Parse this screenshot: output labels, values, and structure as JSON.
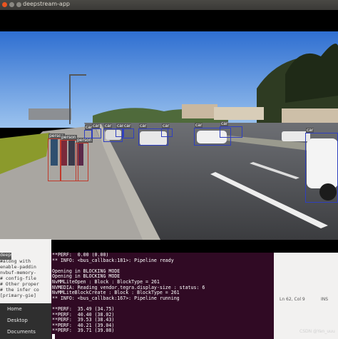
{
  "window": {
    "title": "deepstream-app"
  },
  "detections": [
    {
      "label": "person",
      "color": "#c0392b"
    },
    {
      "label": "person",
      "color": "#c0392b"
    },
    {
      "label": "person",
      "color": "#c0392b"
    },
    {
      "label": "car",
      "color": "#2f3fbf"
    },
    {
      "label": "car",
      "color": "#2f3fbf"
    },
    {
      "label": "car",
      "color": "#2f3fbf"
    },
    {
      "label": "car",
      "color": "#2f3fbf"
    },
    {
      "label": "car",
      "color": "#2f3fbf"
    },
    {
      "label": "car",
      "color": "#2f3fbf"
    },
    {
      "label": "car",
      "color": "#2f3fbf"
    },
    {
      "label": "car",
      "color": "#2f3fbf"
    },
    {
      "label": "car",
      "color": "#2f3fbf"
    },
    {
      "label": "car",
      "color": "#2f3fbf"
    }
  ],
  "editor": {
    "tab_label": "deepstre",
    "lines": [
      "#along with",
      "enable-paddin",
      "nvbuf-memory-",
      "",
      "# config-file",
      "# Other proper",
      "# the infer co",
      "[primary-gie]"
    ]
  },
  "sidebar": {
    "items": [
      "Home",
      "Desktop",
      "Documents"
    ]
  },
  "right_panel": {
    "status": "Ln 62, Col 9",
    "mode": "INS"
  },
  "terminal": {
    "lines": [
      "**PERF:  0.00 (0.00)",
      "** INFO: <bus_callback:181>: Pipeline ready",
      "",
      "Opening in BLOCKING MODE",
      "Opening in BLOCKING MODE",
      "NvMMLiteOpen : Block : BlockType = 261",
      "NVMEDIA: Reading vendor.tegra.display-size : status: 6",
      "NvMMLiteBlockCreate : Block : BlockType = 261",
      "** INFO: <bus_callback:167>: Pipeline running",
      "",
      "**PERF:  35.49 (34.75)",
      "**PERF:  40.40 (38.02)",
      "**PERF:  39.53 (38.43)",
      "**PERF:  40.21 (39.04)",
      "**PERF:  39.71 (39.08)"
    ]
  },
  "watermark": "CSDN @Yan_uuu"
}
